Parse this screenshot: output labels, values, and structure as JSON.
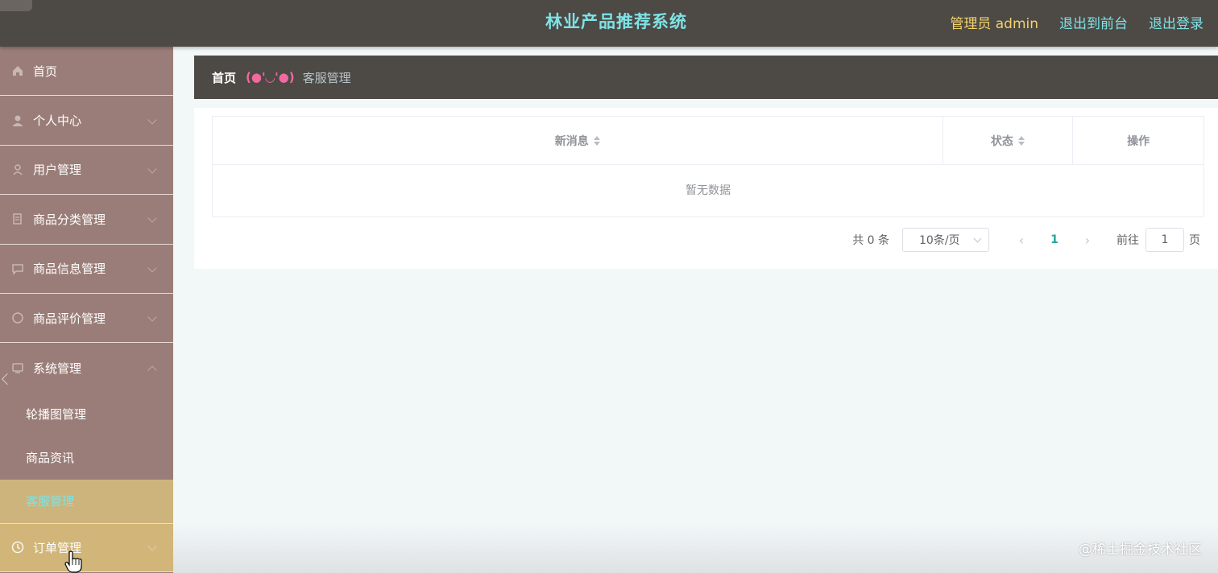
{
  "header": {
    "title": "林业产品推荐系统",
    "admin_label": "管理员 admin",
    "to_front_label": "退出到前台",
    "logout_label": "退出登录"
  },
  "sidebar": {
    "items": [
      {
        "label": "首页",
        "icon": "home-icon"
      },
      {
        "label": "个人中心",
        "icon": "user-icon"
      },
      {
        "label": "用户管理",
        "icon": "users-icon"
      },
      {
        "label": "商品分类管理",
        "icon": "category-icon"
      },
      {
        "label": "商品信息管理",
        "icon": "goods-icon"
      },
      {
        "label": "商品评价管理",
        "icon": "comment-icon"
      },
      {
        "label": "系统管理",
        "icon": "system-icon"
      }
    ],
    "sub_items": [
      "轮播图管理",
      "商品资讯",
      "客服管理"
    ],
    "order_item": {
      "label": "订单管理",
      "icon": "order-icon"
    }
  },
  "breadcrumb": {
    "home": "首页",
    "separator": "(●'◡'●)",
    "current": "客服管理"
  },
  "table": {
    "columns": [
      "新消息",
      "状态",
      "操作"
    ],
    "empty_text": "暂无数据"
  },
  "pagination": {
    "total_text": "共 0 条",
    "page_size": "10条/页",
    "current_page": "1",
    "goto_label": "前往",
    "goto_value": "1",
    "page_unit": "页"
  },
  "watermark": "@稀土掘金技术社区",
  "colors": {
    "header_bg": "#4d4945",
    "title": "#7ee3e6",
    "admin": "#f3d36b",
    "sidebar_bg": "#9a7d78",
    "active_bg": "#cdb47c"
  }
}
